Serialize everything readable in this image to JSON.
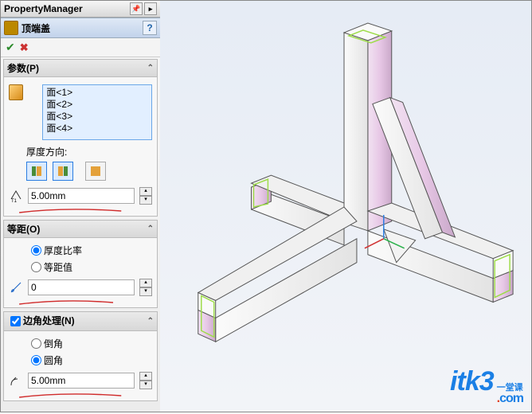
{
  "panel": {
    "title": "PropertyManager",
    "feature": {
      "name": "顶端盖",
      "help": "?"
    },
    "confirm": {
      "ok": "✔",
      "cancel": "✖"
    }
  },
  "params": {
    "header": "参数(P)",
    "faces": [
      "面<1>",
      "面<2>",
      "面<3>",
      "面<4>"
    ],
    "thickness_dir_label": "厚度方向:",
    "thickness_value": "5.00mm"
  },
  "offset": {
    "header": "等距(O)",
    "radio_ratio": "厚度比率",
    "radio_value": "等距值",
    "value": "0"
  },
  "corner": {
    "header": "边角处理(N)",
    "radio_chamfer": "倒角",
    "radio_fillet": "圆角",
    "value": "5.00mm"
  },
  "logo": {
    "brand": "itk3",
    "top": "一堂课",
    "bottom": ".com"
  }
}
